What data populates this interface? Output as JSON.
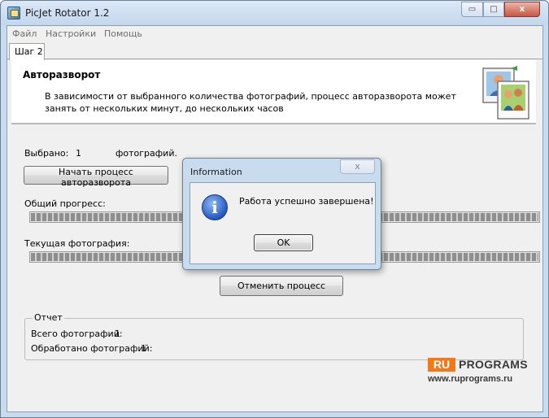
{
  "window": {
    "title": "PicJet Rotator 1.2",
    "controls": {
      "minimize": "▭",
      "maximize": "□",
      "close": "x"
    }
  },
  "menu": [
    "Файл",
    "Настройки",
    "Помощь"
  ],
  "tabs": [
    "Шаг 2"
  ],
  "header": {
    "title": "Авторазворот",
    "description": "В зависимости от выбранного количества фотографий, процесс авторазворота может занять от нескольких минут, до нескольких часов",
    "icon": "photos-rotate-icon"
  },
  "main": {
    "selected_label": "Выбрано:",
    "selected_count": "1",
    "selected_unit": "фотографий.",
    "start_button": "Начать процесс авторазворота",
    "overall_label": "Общий прогресс:",
    "overall_progress": 1.0,
    "current_label": "Текущая фотография:",
    "current_progress": 1.0,
    "cancel_button": "Отменить процесс"
  },
  "report": {
    "legend": "Отчет",
    "total_label": "Всего фотографий:",
    "total_value": "1",
    "processed_label": "Обработано фотографий:",
    "processed_value": "1"
  },
  "dialog": {
    "title": "Information",
    "close": "x",
    "icon": "info-icon",
    "message": "Работа успешно завершена!",
    "ok_button": "OK"
  },
  "watermark": {
    "ru": "RU",
    "programs": "PROGRAMS",
    "url": "www.ruprograms.ru"
  },
  "colors": {
    "accent_orange": "#f07a1a",
    "frame_blue": "#c9dcee"
  }
}
